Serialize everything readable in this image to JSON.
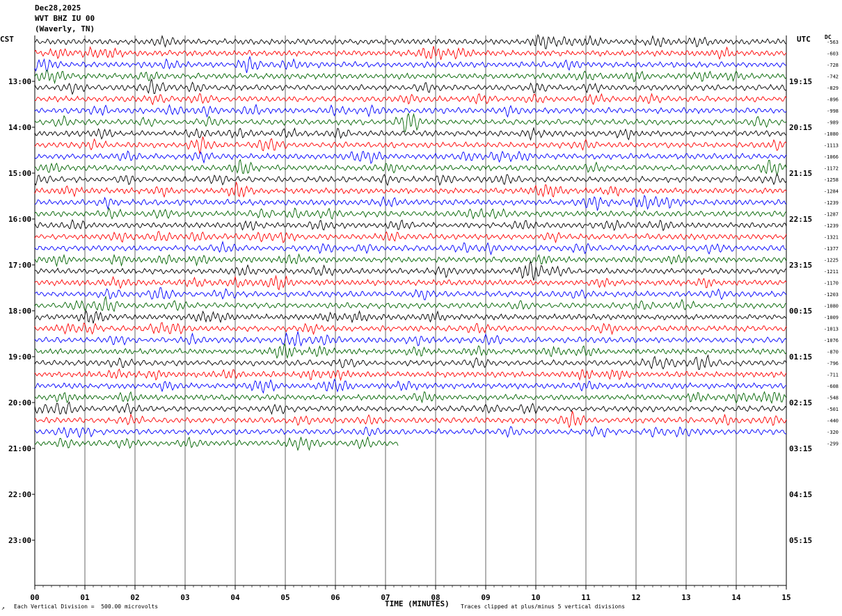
{
  "header": {
    "date": "Dec28,2025",
    "station": "WVT BHZ IU 00",
    "location": "(Waverly, TN)"
  },
  "labels": {
    "left_zone": "CST",
    "right_zone": "UTC",
    "dc": "DC"
  },
  "footer": {
    "scale": "Each Vertical Division =  500.00 microvolts",
    "clip": "Traces clipped at plus/minus 5 vertical divisions",
    "corner_mark": "↗"
  },
  "colors": {
    "trace_cycle": [
      "#000000",
      "#ff0000",
      "#0000ff",
      "#006400"
    ],
    "grid": "#000000",
    "background": "#ffffff"
  },
  "chart_data": {
    "type": "line",
    "subtype": "helicorder (seismogram drum plot)",
    "xlabel": "TIME (MINUTES)",
    "x_ticks": [
      "00",
      "01",
      "02",
      "03",
      "04",
      "05",
      "06",
      "07",
      "08",
      "09",
      "10",
      "11",
      "12",
      "13",
      "14",
      "15"
    ],
    "xlim": [
      0,
      15
    ],
    "minutes_per_trace": 15,
    "left_hour_labels": [
      "13:00",
      "14:00",
      "15:00",
      "16:00",
      "17:00",
      "18:00",
      "19:00",
      "20:00",
      "21:00",
      "22:00",
      "23:00"
    ],
    "right_hour_labels": [
      "19:15",
      "20:15",
      "21:15",
      "22:15",
      "23:15",
      "00:15",
      "01:15",
      "02:15",
      "03:15",
      "04:15",
      "05:15"
    ],
    "dc_offsets": [
      "-563",
      "-603",
      "-728",
      "-742",
      "-829",
      "-896",
      "-998",
      "-989",
      "-1080",
      "-1113",
      "-1066",
      "-1172",
      "-1258",
      "-1284",
      "-1239",
      "-1287",
      "-1239",
      "-1321",
      "-1377",
      "-1225",
      "-1211",
      "-1170",
      "-1203",
      "-1080",
      "-1009",
      "-1013",
      "-1076",
      "-870",
      "-796",
      "-711",
      "-608",
      "-548",
      "-501",
      "-440",
      "-320",
      "-299"
    ],
    "trace_count": 36,
    "last_trace_end_minute": 7.25,
    "scale_microvolts_per_division": 500,
    "clip_divisions": 5
  }
}
